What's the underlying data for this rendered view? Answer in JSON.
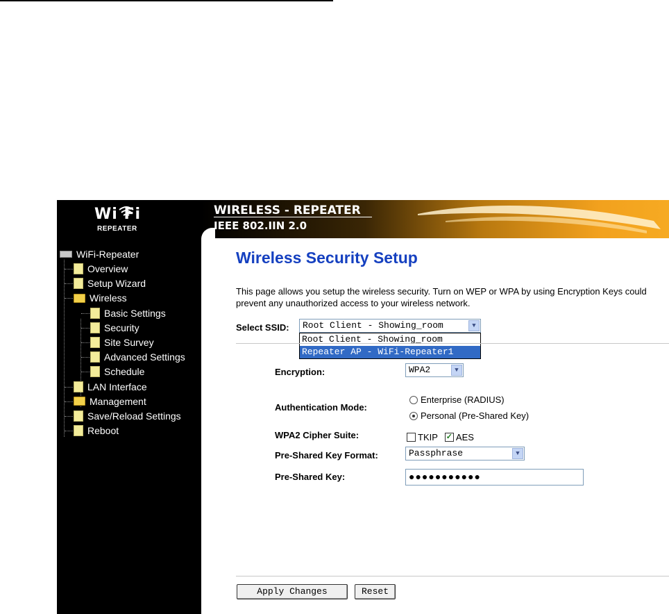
{
  "banner": {
    "logo_text": "Wi Fi",
    "logo_sub": "REPEATER",
    "title_line1": "WIRELESS - REPEATER",
    "title_line2": "IEEE 802.IIN 2.0"
  },
  "sidebar": {
    "root": "WiFi-Repeater",
    "items": [
      {
        "label": "Overview",
        "icon": "document-icon"
      },
      {
        "label": "Setup Wizard",
        "icon": "document-icon"
      },
      {
        "label": "Wireless",
        "icon": "open-folder-icon"
      },
      {
        "label": "Basic Settings",
        "icon": "document-icon"
      },
      {
        "label": "Security",
        "icon": "document-icon"
      },
      {
        "label": "Site Survey",
        "icon": "document-icon"
      },
      {
        "label": "Advanced Settings",
        "icon": "document-icon"
      },
      {
        "label": "Schedule",
        "icon": "document-icon"
      },
      {
        "label": "LAN Interface",
        "icon": "document-icon"
      },
      {
        "label": "Management",
        "icon": "folder-icon"
      },
      {
        "label": "Save/Reload Settings",
        "icon": "document-icon"
      },
      {
        "label": "Reboot",
        "icon": "document-icon"
      }
    ]
  },
  "page": {
    "title": "Wireless Security Setup",
    "description": "This page allows you setup the wireless security. Turn on WEP or WPA by using Encryption Keys could prevent any unauthorized access to your wireless network."
  },
  "ssid": {
    "label": "Select SSID:",
    "selected": "Root Client - Showing_room",
    "options": [
      "Root Client - Showing_room",
      "Repeater AP - WiFi-Repeater1"
    ],
    "highlighted_option": "Repeater AP - WiFi-Repeater1"
  },
  "form": {
    "encryption_label": "Encryption:",
    "encryption_value": "WPA2",
    "auth_label": "Authentication Mode:",
    "auth_option_enterprise": "Enterprise (RADIUS)",
    "auth_option_personal": "Personal (Pre-Shared Key)",
    "auth_selected": "Personal (Pre-Shared Key)",
    "cipher_label": "WPA2 Cipher Suite:",
    "cipher_tkip": "TKIP",
    "cipher_tkip_checked": false,
    "cipher_aes": "AES",
    "cipher_aes_checked": true,
    "psk_format_label": "Pre-Shared Key Format:",
    "psk_format_value": "Passphrase",
    "psk_label": "Pre-Shared Key:",
    "psk_value": "●●●●●●●●●●●"
  },
  "buttons": {
    "apply": "Apply Changes",
    "reset": "Reset"
  },
  "colors": {
    "title_blue": "#1540c0",
    "banner_orange": "#f0a020",
    "selection_blue": "#316ac5"
  }
}
